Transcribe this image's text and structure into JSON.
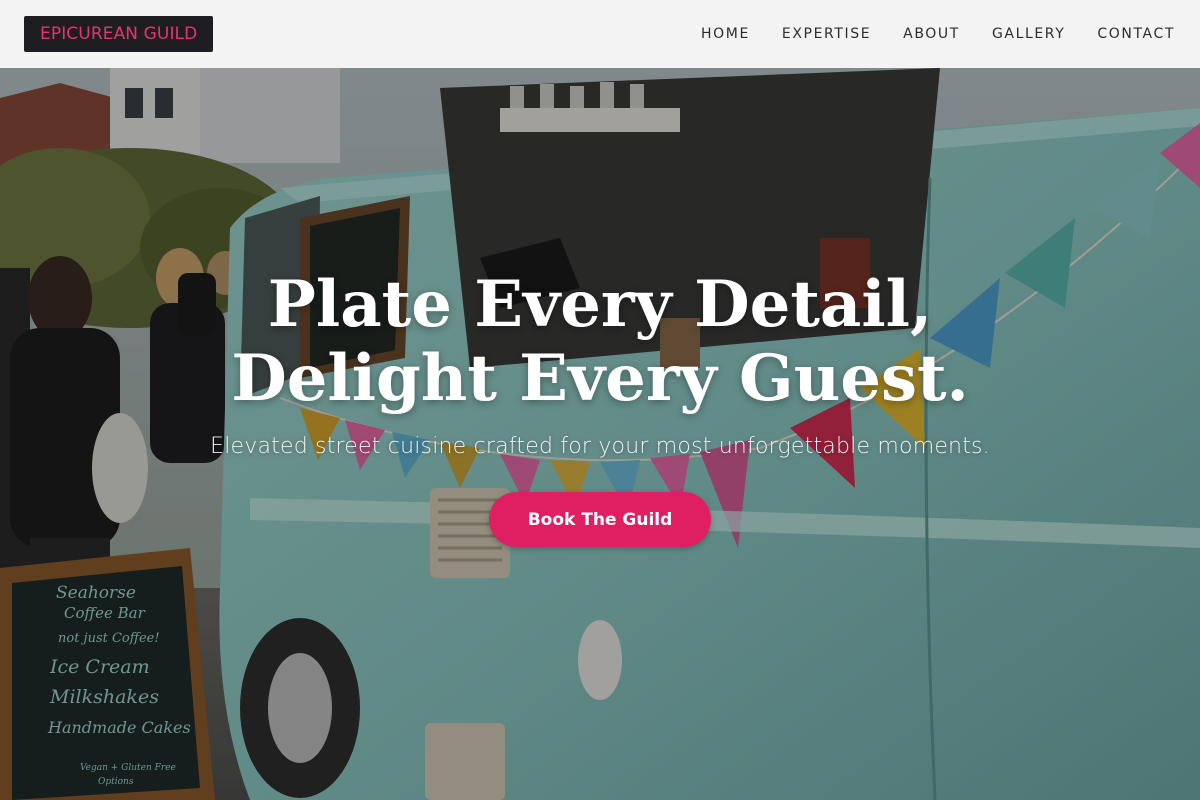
{
  "brand": {
    "logo_text": "EPICUREAN GUILD",
    "logo_color": "#e8336f",
    "logo_bg": "#1e1e22"
  },
  "nav": {
    "items": [
      "HOME",
      "EXPERTISE",
      "ABOUT",
      "GALLERY",
      "CONTACT"
    ]
  },
  "hero": {
    "title_line1": "Plate Every Detail,",
    "title_line2": "Delight Every Guest.",
    "subtitle": "Elevated street cuisine crafted for your most unforgettable moments.",
    "cta_label": "Book The Guild",
    "cta_color": "#e01f63",
    "background_description_icon": "food-truck-photo",
    "chalkboard_lines": [
      "Seahorse",
      "Coffee Bar",
      "not just Coffee!",
      "Ice Cream",
      "Milkshakes",
      "Handmade Cakes",
      "Vegan + Gluten Free",
      "Options"
    ]
  }
}
